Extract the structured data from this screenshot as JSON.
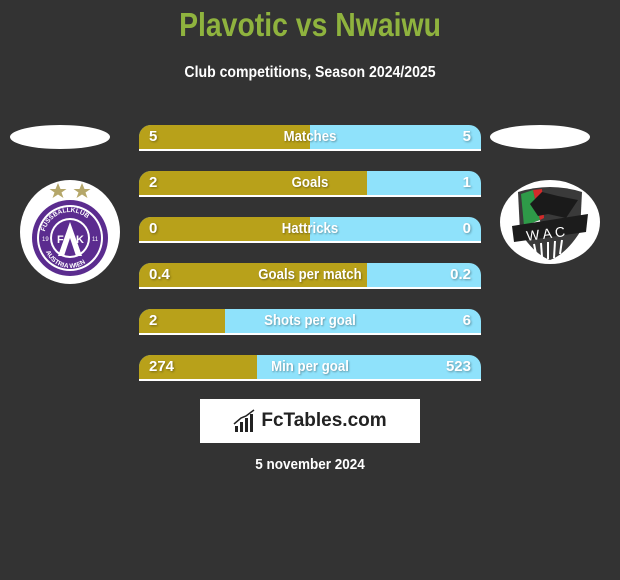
{
  "header": {
    "title": "Plavotic vs Nwaiwu",
    "subtitle": "Club competitions, Season 2024/2025"
  },
  "teams": {
    "left": {
      "name_oval": "",
      "logo": "austria-wien-crest-icon",
      "crest_text_top": "FUSSBALLKLUB",
      "crest_text_bottom": "AUSTRIA WIEN",
      "crest_initials": "FAK",
      "year_left": "19",
      "year_right": "11"
    },
    "right": {
      "name_oval": "",
      "logo": "wac-crest-icon",
      "crest_initials": "WAC"
    }
  },
  "colors": {
    "title": "#8fb33e",
    "left_bar": "#b8a11a",
    "right_bar": "#8fe2fb",
    "background": "#333333"
  },
  "stats": [
    {
      "label": "Matches",
      "left": "5",
      "right": "5",
      "left_share": 0.5
    },
    {
      "label": "Goals",
      "left": "2",
      "right": "1",
      "left_share": 0.667
    },
    {
      "label": "Hattricks",
      "left": "0",
      "right": "0",
      "left_share": 0.5
    },
    {
      "label": "Goals per match",
      "left": "0.4",
      "right": "0.2",
      "left_share": 0.667
    },
    {
      "label": "Shots per goal",
      "left": "2",
      "right": "6",
      "left_share": 0.25
    },
    {
      "label": "Min per goal",
      "left": "274",
      "right": "523",
      "left_share": 0.344
    }
  ],
  "brand": {
    "icon": "bar-chart-icon",
    "text": "FcTables.com"
  },
  "footer": {
    "date": "5 november 2024"
  }
}
